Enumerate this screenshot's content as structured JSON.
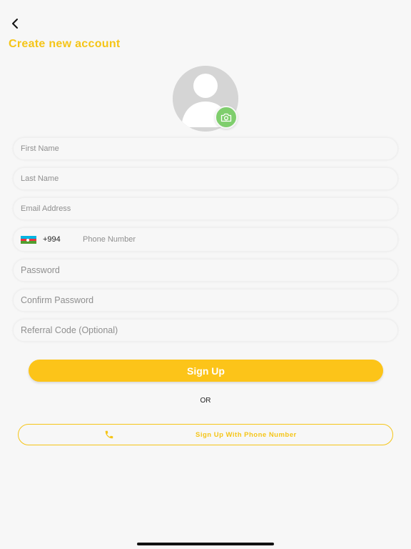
{
  "header": {
    "title": "Create new account"
  },
  "avatar": {
    "icon": "user-placeholder-icon",
    "camera_icon": "camera-icon",
    "camera_color": "#7fce6d"
  },
  "form": {
    "first_name": {
      "placeholder": "First Name",
      "value": ""
    },
    "last_name": {
      "placeholder": "Last Name",
      "value": ""
    },
    "email": {
      "placeholder": "Email Address",
      "value": ""
    },
    "phone": {
      "country_flag": "azerbaijan-flag",
      "dial_code": "+994",
      "placeholder": "Phone Number",
      "value": ""
    },
    "password": {
      "placeholder": "Password",
      "value": ""
    },
    "confirm_password": {
      "placeholder": "Confirm Password",
      "value": ""
    },
    "referral_code": {
      "placeholder": "Referral Code (Optional)",
      "value": ""
    }
  },
  "actions": {
    "signup_label": "Sign Up",
    "or_label": "OR",
    "phone_signup_label": "Sign Up With Phone Number",
    "accent_color": "#fcc419"
  }
}
